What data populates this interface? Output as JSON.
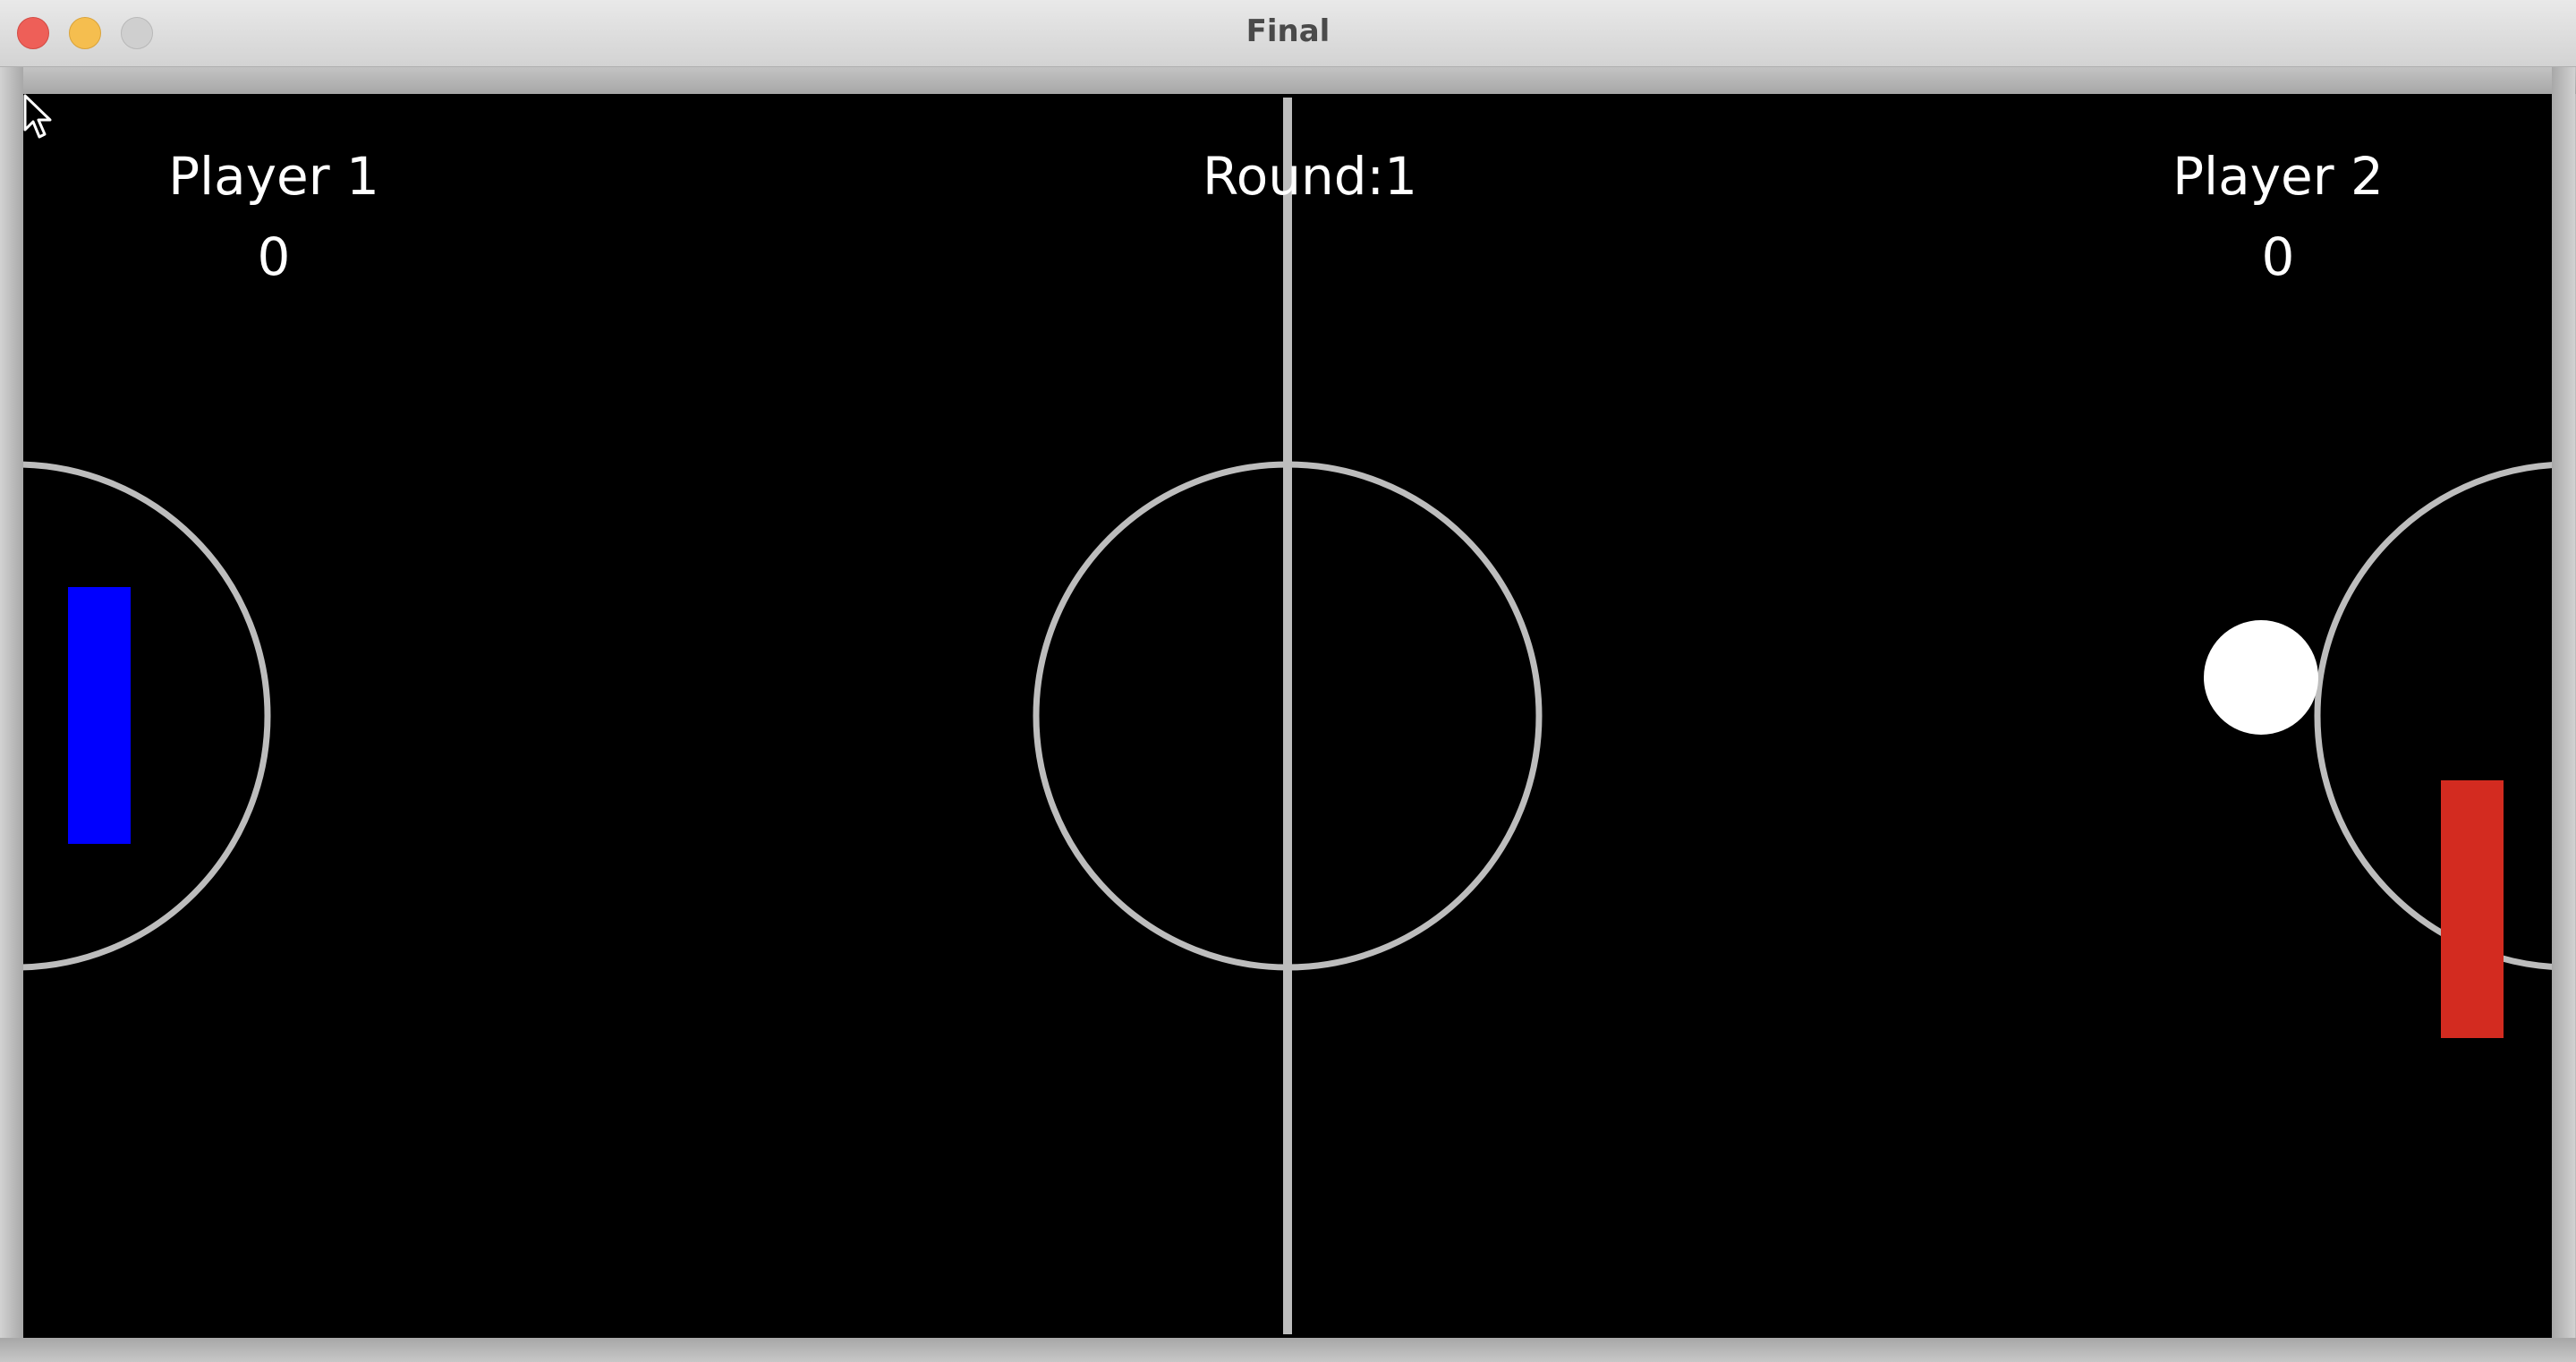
{
  "window": {
    "title": "Final"
  },
  "scoreboard": {
    "player1_name": "Player 1",
    "player1_score": "0",
    "player2_name": "Player 2",
    "player2_score": "0",
    "round_label": "Round:",
    "round_value": "1"
  },
  "colors": {
    "background": "#000000",
    "field_lines": "#bdbdbd",
    "player1_paddle": "#0000ff",
    "player2_paddle": "#d32b20",
    "ball": "#ffffff",
    "text": "#ffffff"
  },
  "icons": {
    "cursor": "arrow-cursor-icon"
  }
}
